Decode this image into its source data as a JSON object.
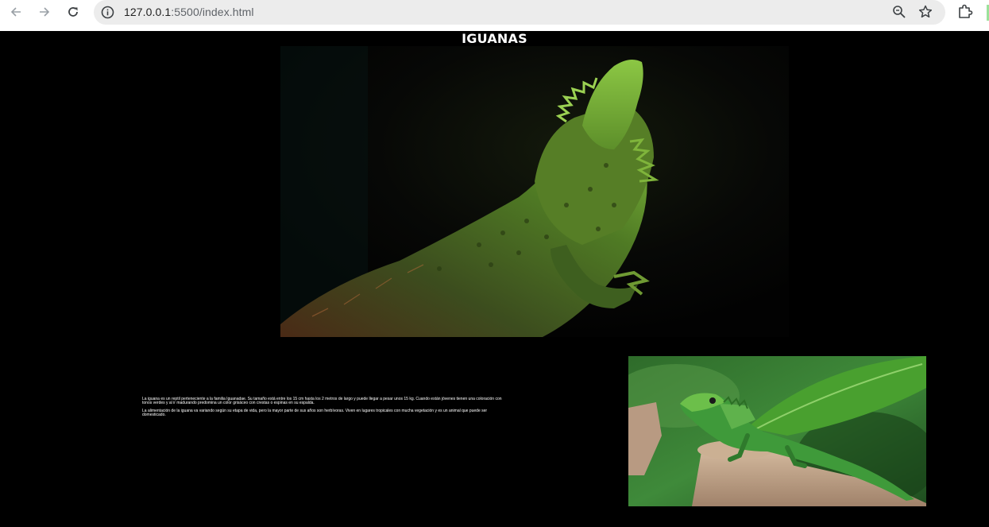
{
  "browser": {
    "url_host": "127.0.0.1",
    "url_rest": ":5500/index.html",
    "icons": [
      "back-arrow-icon",
      "forward-arrow-icon",
      "reload-icon",
      "info-icon",
      "zoom-icon",
      "star-icon",
      "extensions-icon"
    ]
  },
  "page": {
    "title": "IGUANAS",
    "paragraphs": [
      "La iguana es un reptil perteneciente a la familia Iguanadae. Su tamaño está entre los 15 cm hasta los 2 metros de largo y puede llegar a pesar unos 15 kg. Cuando están jóvenes tienen una coloración con tonos verdes y al ir madurando predomina un color grisáceo con crestas o espinas en su espalda.",
      "La alimentación de la iguana va variando según su etapa de vida, pero la mayor parte de sus años son herbívoras. Viven en lugares tropicales con mucha vegetación y es un animal que puede ser domesticado."
    ]
  },
  "colors": {
    "page_background": "#000000",
    "text": "#ffffff",
    "omnibox": "#ececec"
  }
}
